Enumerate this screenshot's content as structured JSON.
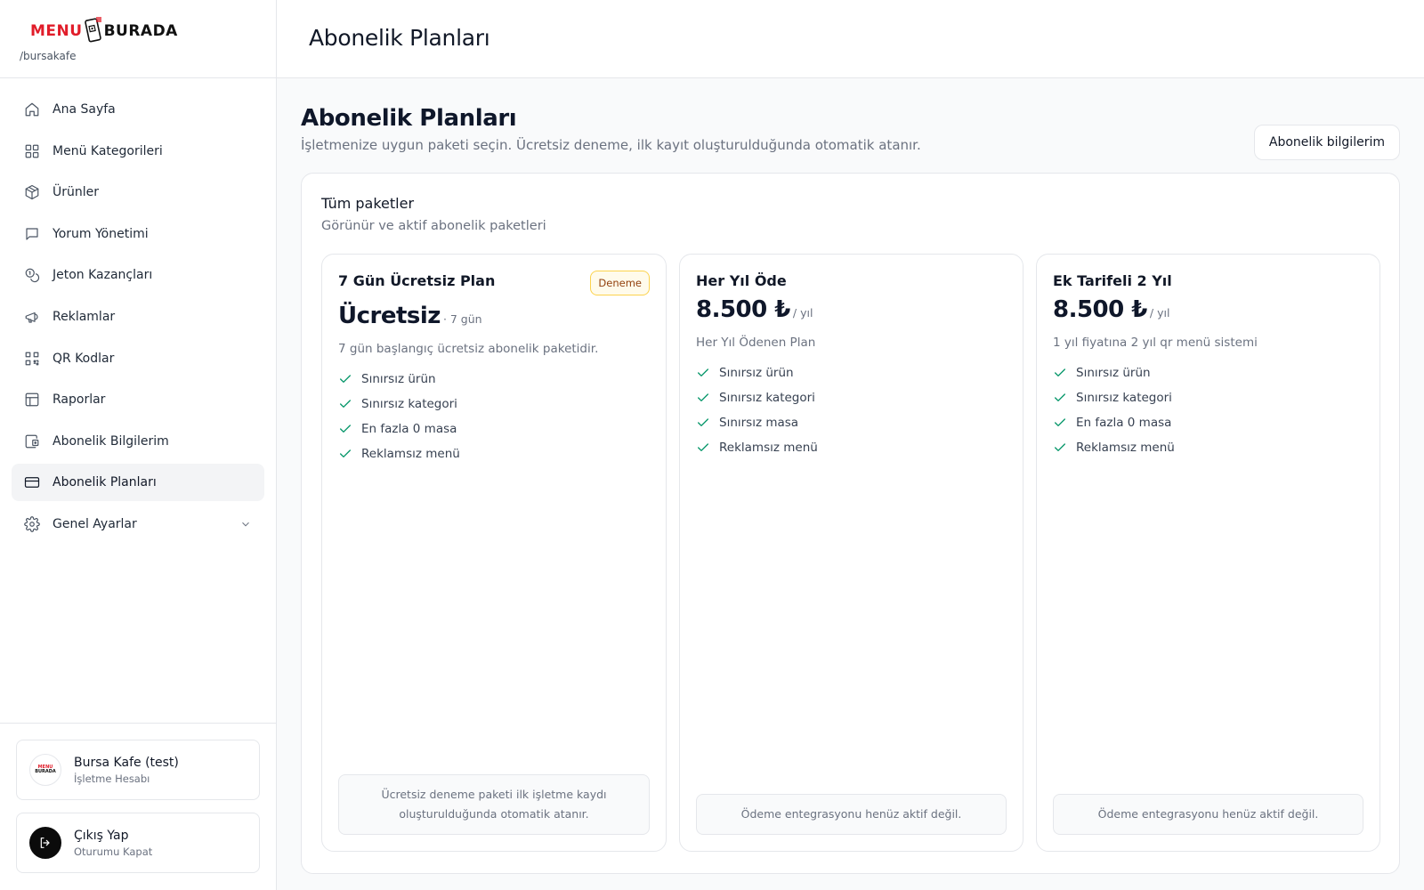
{
  "brand": {
    "logo_left": "MENU",
    "logo_right": "BURADA",
    "slug": "/bursakafe"
  },
  "sidebar": {
    "items": [
      {
        "label": "Ana Sayfa",
        "icon": "home-icon"
      },
      {
        "label": "Menü Kategorileri",
        "icon": "grid-icon"
      },
      {
        "label": "Ürünler",
        "icon": "box-icon"
      },
      {
        "label": "Yorum Yönetimi",
        "icon": "message-icon"
      },
      {
        "label": "Jeton Kazançları",
        "icon": "coins-icon"
      },
      {
        "label": "Reklamlar",
        "icon": "megaphone-icon"
      },
      {
        "label": "QR Kodlar",
        "icon": "qr-code-icon"
      },
      {
        "label": "Raporlar",
        "icon": "layout-icon"
      },
      {
        "label": "Abonelik Bilgilerim",
        "icon": "wallet-icon"
      },
      {
        "label": "Abonelik Planları",
        "icon": "credit-card-icon",
        "active": true
      },
      {
        "label": "Genel Ayarlar",
        "icon": "gear-icon",
        "expandable": true
      }
    ]
  },
  "account": {
    "name": "Bursa Kafe (test)",
    "type": "İşletme Hesabı",
    "avatar_top": "MENU",
    "avatar_bottom": "BURADA"
  },
  "logout": {
    "label": "Çıkış Yap",
    "sub": "Oturumu Kapat"
  },
  "header": {
    "title": "Abonelik Planları"
  },
  "page": {
    "title": "Abonelik Planları",
    "description": "İşletmenize uygun paketi seçin. Ücretsiz deneme, ilk kayıt oluşturulduğunda otomatik atanır.",
    "info_button": "Abonelik bilgilerim"
  },
  "panel": {
    "title": "Tüm paketler",
    "subtitle": "Görünür ve aktif abonelik paketleri"
  },
  "plans": [
    {
      "name": "7 Gün Ücretsiz Plan",
      "badge": "Deneme",
      "price": "Ücretsiz",
      "period": "· 7 gün",
      "description": "7 gün başlangıç ücretsiz abonelik paketidir.",
      "features": [
        "Sınırsız ürün",
        "Sınırsız kategori",
        "En fazla 0 masa",
        "Reklamsız menü"
      ],
      "note": "Ücretsiz deneme paketi ilk işletme kaydı oluşturulduğunda otomatik atanır."
    },
    {
      "name": "Her Yıl Öde",
      "badge": "",
      "price": "8.500 ₺",
      "period": "/ yıl",
      "description": "Her Yıl Ödenen Plan",
      "features": [
        "Sınırsız ürün",
        "Sınırsız kategori",
        "Sınırsız masa",
        "Reklamsız menü"
      ],
      "note": "Ödeme entegrasyonu henüz aktif değil."
    },
    {
      "name": "Ek Tarifeli 2 Yıl",
      "badge": "",
      "price": "8.500 ₺",
      "period": "/ yıl",
      "description": "1 yıl fiyatına 2 yıl qr menü sistemi",
      "features": [
        "Sınırsız ürün",
        "Sınırsız kategori",
        "En fazla 0 masa",
        "Reklamsız menü"
      ],
      "note": "Ödeme entegrasyonu henüz aktif değil."
    }
  ],
  "colors": {
    "brand_red": "#e11d2a",
    "check_green": "#059669",
    "badge_border": "#fcd34d",
    "active_bg": "#f3f4f6"
  }
}
